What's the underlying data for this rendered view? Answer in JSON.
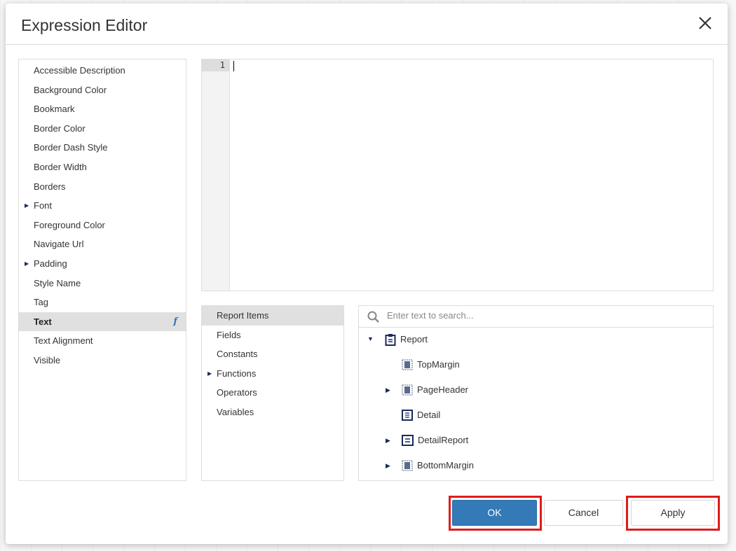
{
  "dialog": {
    "title": "Expression Editor",
    "close_icon": "close-icon"
  },
  "properties": [
    {
      "label": "Accessible Description"
    },
    {
      "label": "Background Color"
    },
    {
      "label": "Bookmark"
    },
    {
      "label": "Border Color"
    },
    {
      "label": "Border Dash Style"
    },
    {
      "label": "Border Width"
    },
    {
      "label": "Borders"
    },
    {
      "label": "Font",
      "expandable": true
    },
    {
      "label": "Foreground Color"
    },
    {
      "label": "Navigate Url"
    },
    {
      "label": "Padding",
      "expandable": true
    },
    {
      "label": "Style Name"
    },
    {
      "label": "Tag"
    },
    {
      "label": "Text",
      "selected": true,
      "fx": "f"
    },
    {
      "label": "Text Alignment"
    },
    {
      "label": "Visible"
    }
  ],
  "editor": {
    "line_number": "1",
    "content": ""
  },
  "categories": [
    {
      "label": "Report Items",
      "selected": true
    },
    {
      "label": "Fields"
    },
    {
      "label": "Constants"
    },
    {
      "label": "Functions",
      "expandable": true
    },
    {
      "label": "Operators"
    },
    {
      "label": "Variables"
    }
  ],
  "tree": {
    "search_placeholder": "Enter text to search...",
    "nodes": [
      {
        "label": "Report",
        "expanded": true
      },
      {
        "label": "TopMargin"
      },
      {
        "label": "PageHeader",
        "expandable": true
      },
      {
        "label": "Detail"
      },
      {
        "label": "DetailReport",
        "expandable": true
      },
      {
        "label": "BottomMargin",
        "expandable": true
      }
    ]
  },
  "buttons": {
    "ok": "OK",
    "cancel": "Cancel",
    "apply": "Apply"
  },
  "colors": {
    "primary": "#337ab7",
    "highlight": "#e01b1b",
    "icon": "#1a2a5a"
  }
}
